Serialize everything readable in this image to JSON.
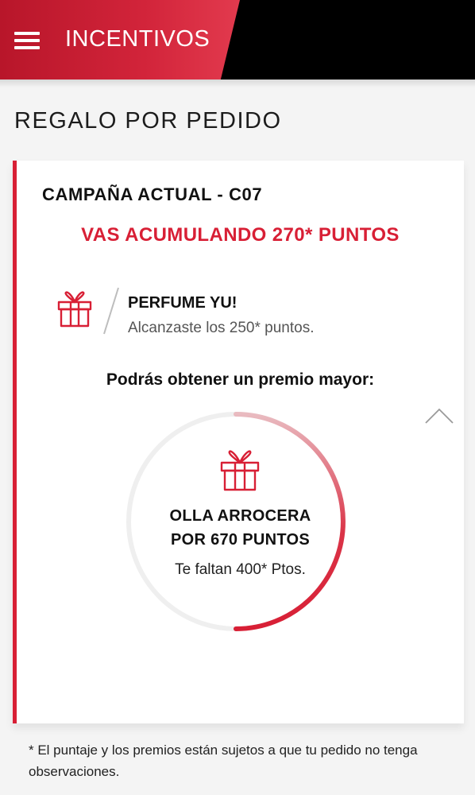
{
  "header": {
    "title": "INCENTIVOS",
    "menu_icon": "hamburger-menu-icon",
    "accent": "#d81f35"
  },
  "page": {
    "title": "REGALO POR PEDIDO"
  },
  "card": {
    "campaign": "CAMPAÑA ACTUAL - C07",
    "points_text": "VAS ACUMULANDO 270* PUNTOS",
    "achieved": {
      "icon": "gift-icon",
      "name": "PERFUME YU!",
      "description": "Alcanzaste los 250* puntos."
    },
    "next_prize_heading": "Podrás obtener un premio mayor:",
    "next_prize": {
      "icon": "gift-icon",
      "line1": "OLLA ARROCERA",
      "line2": "POR 670 PUNTOS",
      "remaining": "Te faltan 400* Ptos.",
      "progress_fraction": 0.5
    },
    "collapse_icon": "chevron-up-icon"
  },
  "footnote": "* El puntaje y los premios están sujetos a que tu pedido no tenga observaciones."
}
